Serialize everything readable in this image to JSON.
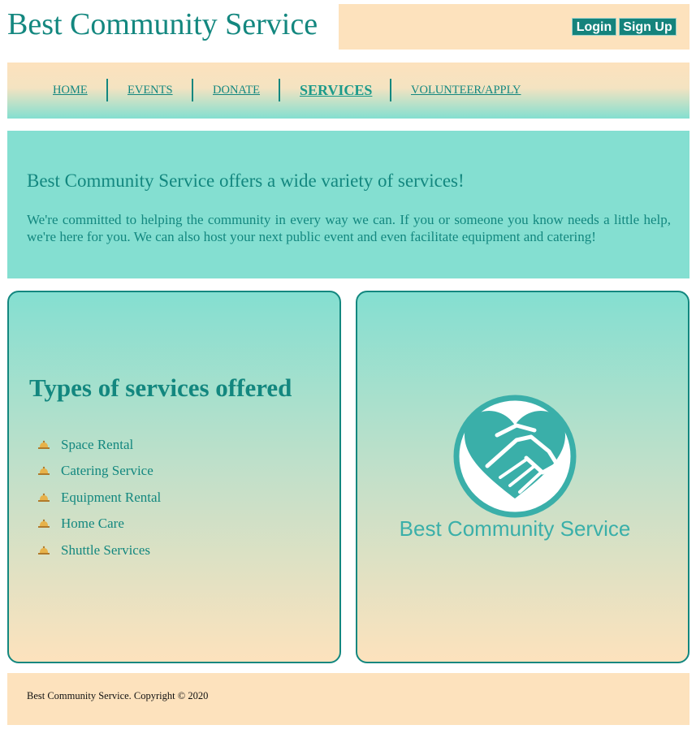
{
  "header": {
    "site_title": "Best Community Service",
    "login_label": "Login",
    "signup_label": "Sign Up"
  },
  "nav": {
    "items": [
      {
        "label": "HOME",
        "active": false
      },
      {
        "label": "EVENTS",
        "active": false
      },
      {
        "label": "DONATE",
        "active": false
      },
      {
        "label": "SERVICES",
        "active": true
      },
      {
        "label": "VOLUNTEER/APPLY",
        "active": false
      }
    ]
  },
  "intro": {
    "heading": "Best Community Service offers a wide variety of services!",
    "text": "We're committed to helping the community in every way we can. If you or someone you know needs a little help, we're here for you. We can also host your next public event and even facilitate equipment and catering!"
  },
  "services": {
    "title": "Types of services offered",
    "items": [
      "Space Rental",
      "Catering Service",
      "Equipment Rental",
      "Home Care",
      "Shuttle Services"
    ],
    "bullet_icon": "service-bell-icon"
  },
  "logo": {
    "text": "Best Community Service",
    "icon": "handshake-heart-logo"
  },
  "footer": {
    "copyright": "Best Community Service. Copyright © 2020"
  },
  "colors": {
    "teal": "#13877f",
    "mint": "#84dfd1",
    "peach": "#fde2bd",
    "logo_teal": "#3aafa9"
  }
}
